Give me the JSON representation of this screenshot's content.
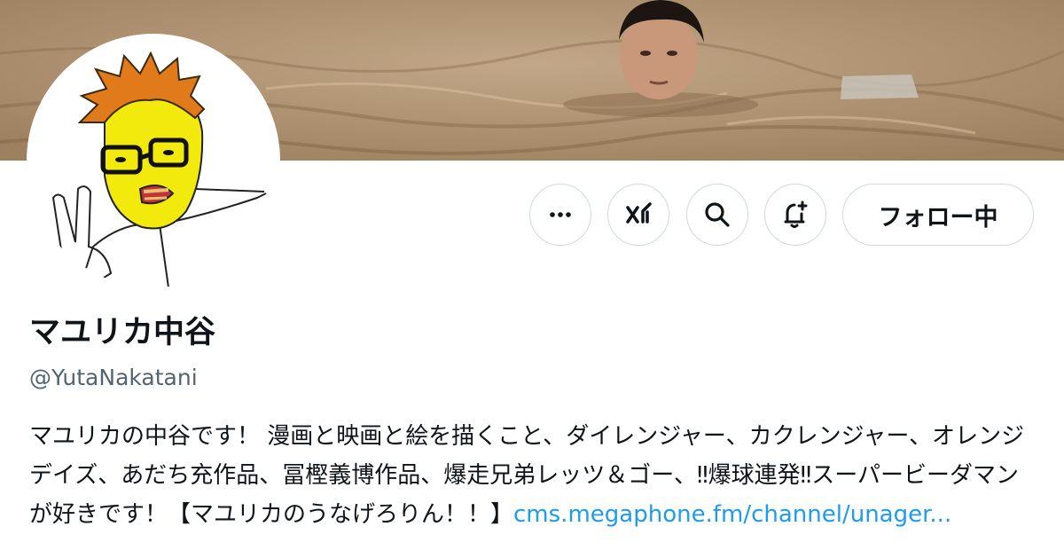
{
  "header": {
    "banner_image": "sand-beach-person-buried-photo"
  },
  "profile": {
    "avatar": "cartoon-self-portrait-yellow-face-avatar",
    "display_name": "マユリカ中谷",
    "handle": "@YutaNakatani",
    "bio_text": "マユリカの中谷です！ 漫画と映画と絵を描くこと、ダイレンジャー、カクレンジャー、オレンジデイズ、あだち充作品、冨樫義博作品、爆走兄弟レッツ＆ゴー、‼爆球連発‼スーパービーダマンが好きです！【マユリカのうなげろりん！！】",
    "bio_link": "cms.megaphone.fm/channel/unager..."
  },
  "actions": {
    "more_icon": "ellipsis-icon",
    "grok_icon": "grok-icon",
    "search_icon": "search-icon",
    "notify_icon": "bell-plus-icon",
    "follow_label": "フォロー中"
  },
  "colors": {
    "link": "#1d9bf0",
    "secondary_text": "#536471",
    "border": "#cfd9de",
    "avatar_face": "#f2ea0c",
    "avatar_hair": "#e07a1a"
  }
}
